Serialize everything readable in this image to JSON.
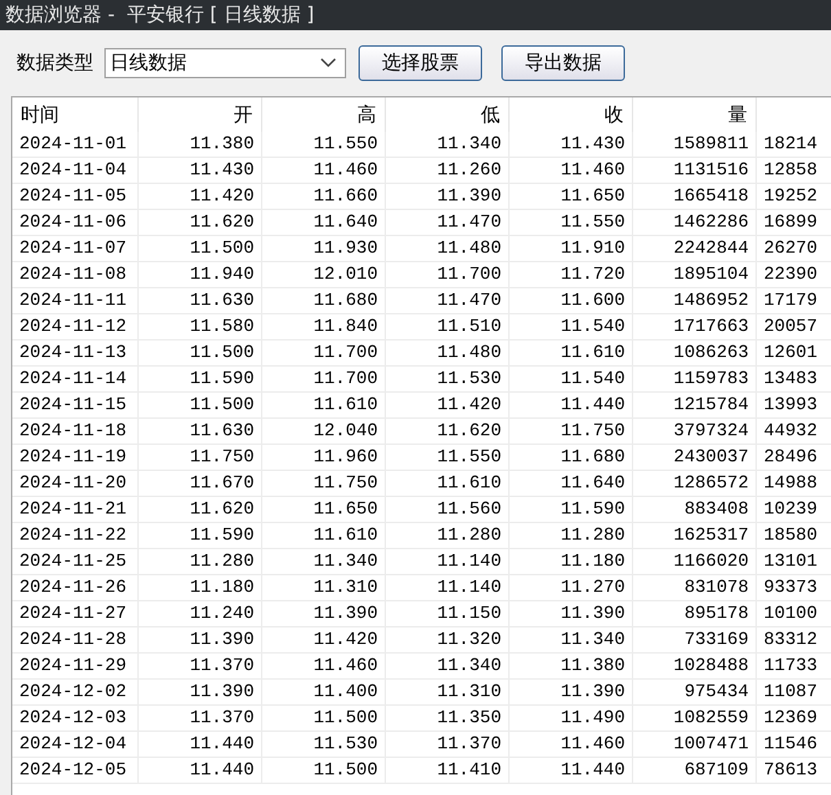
{
  "window": {
    "title": "数据浏览器 -  平安银行 [ 日线数据 ]"
  },
  "toolbar": {
    "label": "数据类型",
    "dropdown": {
      "value": "日线数据"
    },
    "buttons": [
      "选择股票",
      "导出数据"
    ]
  },
  "table": {
    "columns": [
      "时间",
      "开",
      "高",
      "低",
      "收",
      "量"
    ],
    "rows": [
      [
        "2024-11-01",
        "11.380",
        "11.550",
        "11.340",
        "11.430",
        "1589811",
        "18214"
      ],
      [
        "2024-11-04",
        "11.430",
        "11.460",
        "11.260",
        "11.460",
        "1131516",
        "12858"
      ],
      [
        "2024-11-05",
        "11.420",
        "11.660",
        "11.390",
        "11.650",
        "1665418",
        "19252"
      ],
      [
        "2024-11-06",
        "11.620",
        "11.640",
        "11.470",
        "11.550",
        "1462286",
        "16899"
      ],
      [
        "2024-11-07",
        "11.500",
        "11.930",
        "11.480",
        "11.910",
        "2242844",
        "26270"
      ],
      [
        "2024-11-08",
        "11.940",
        "12.010",
        "11.700",
        "11.720",
        "1895104",
        "22390"
      ],
      [
        "2024-11-11",
        "11.630",
        "11.680",
        "11.470",
        "11.600",
        "1486952",
        "17179"
      ],
      [
        "2024-11-12",
        "11.580",
        "11.840",
        "11.510",
        "11.540",
        "1717663",
        "20057"
      ],
      [
        "2024-11-13",
        "11.500",
        "11.700",
        "11.480",
        "11.610",
        "1086263",
        "12601"
      ],
      [
        "2024-11-14",
        "11.590",
        "11.700",
        "11.530",
        "11.540",
        "1159783",
        "13483"
      ],
      [
        "2024-11-15",
        "11.500",
        "11.610",
        "11.420",
        "11.440",
        "1215784",
        "13993"
      ],
      [
        "2024-11-18",
        "11.630",
        "12.040",
        "11.620",
        "11.750",
        "3797324",
        "44932"
      ],
      [
        "2024-11-19",
        "11.750",
        "11.960",
        "11.550",
        "11.680",
        "2430037",
        "28496"
      ],
      [
        "2024-11-20",
        "11.670",
        "11.750",
        "11.610",
        "11.640",
        "1286572",
        "14988"
      ],
      [
        "2024-11-21",
        "11.620",
        "11.650",
        "11.560",
        "11.590",
        "883408",
        "10239"
      ],
      [
        "2024-11-22",
        "11.590",
        "11.610",
        "11.280",
        "11.280",
        "1625317",
        "18580"
      ],
      [
        "2024-11-25",
        "11.280",
        "11.340",
        "11.140",
        "11.180",
        "1166020",
        "13101"
      ],
      [
        "2024-11-26",
        "11.180",
        "11.310",
        "11.140",
        "11.270",
        "831078",
        "93373"
      ],
      [
        "2024-11-27",
        "11.240",
        "11.390",
        "11.150",
        "11.390",
        "895178",
        "10100"
      ],
      [
        "2024-11-28",
        "11.390",
        "11.420",
        "11.320",
        "11.340",
        "733169",
        "83312"
      ],
      [
        "2024-11-29",
        "11.370",
        "11.460",
        "11.340",
        "11.380",
        "1028488",
        "11733"
      ],
      [
        "2024-12-02",
        "11.390",
        "11.400",
        "11.310",
        "11.390",
        "975434",
        "11087"
      ],
      [
        "2024-12-03",
        "11.370",
        "11.500",
        "11.350",
        "11.490",
        "1082559",
        "12369"
      ],
      [
        "2024-12-04",
        "11.440",
        "11.530",
        "11.370",
        "11.460",
        "1007471",
        "11546"
      ],
      [
        "2024-12-05",
        "11.440",
        "11.500",
        "11.410",
        "11.440",
        "687109",
        "78613"
      ]
    ]
  }
}
